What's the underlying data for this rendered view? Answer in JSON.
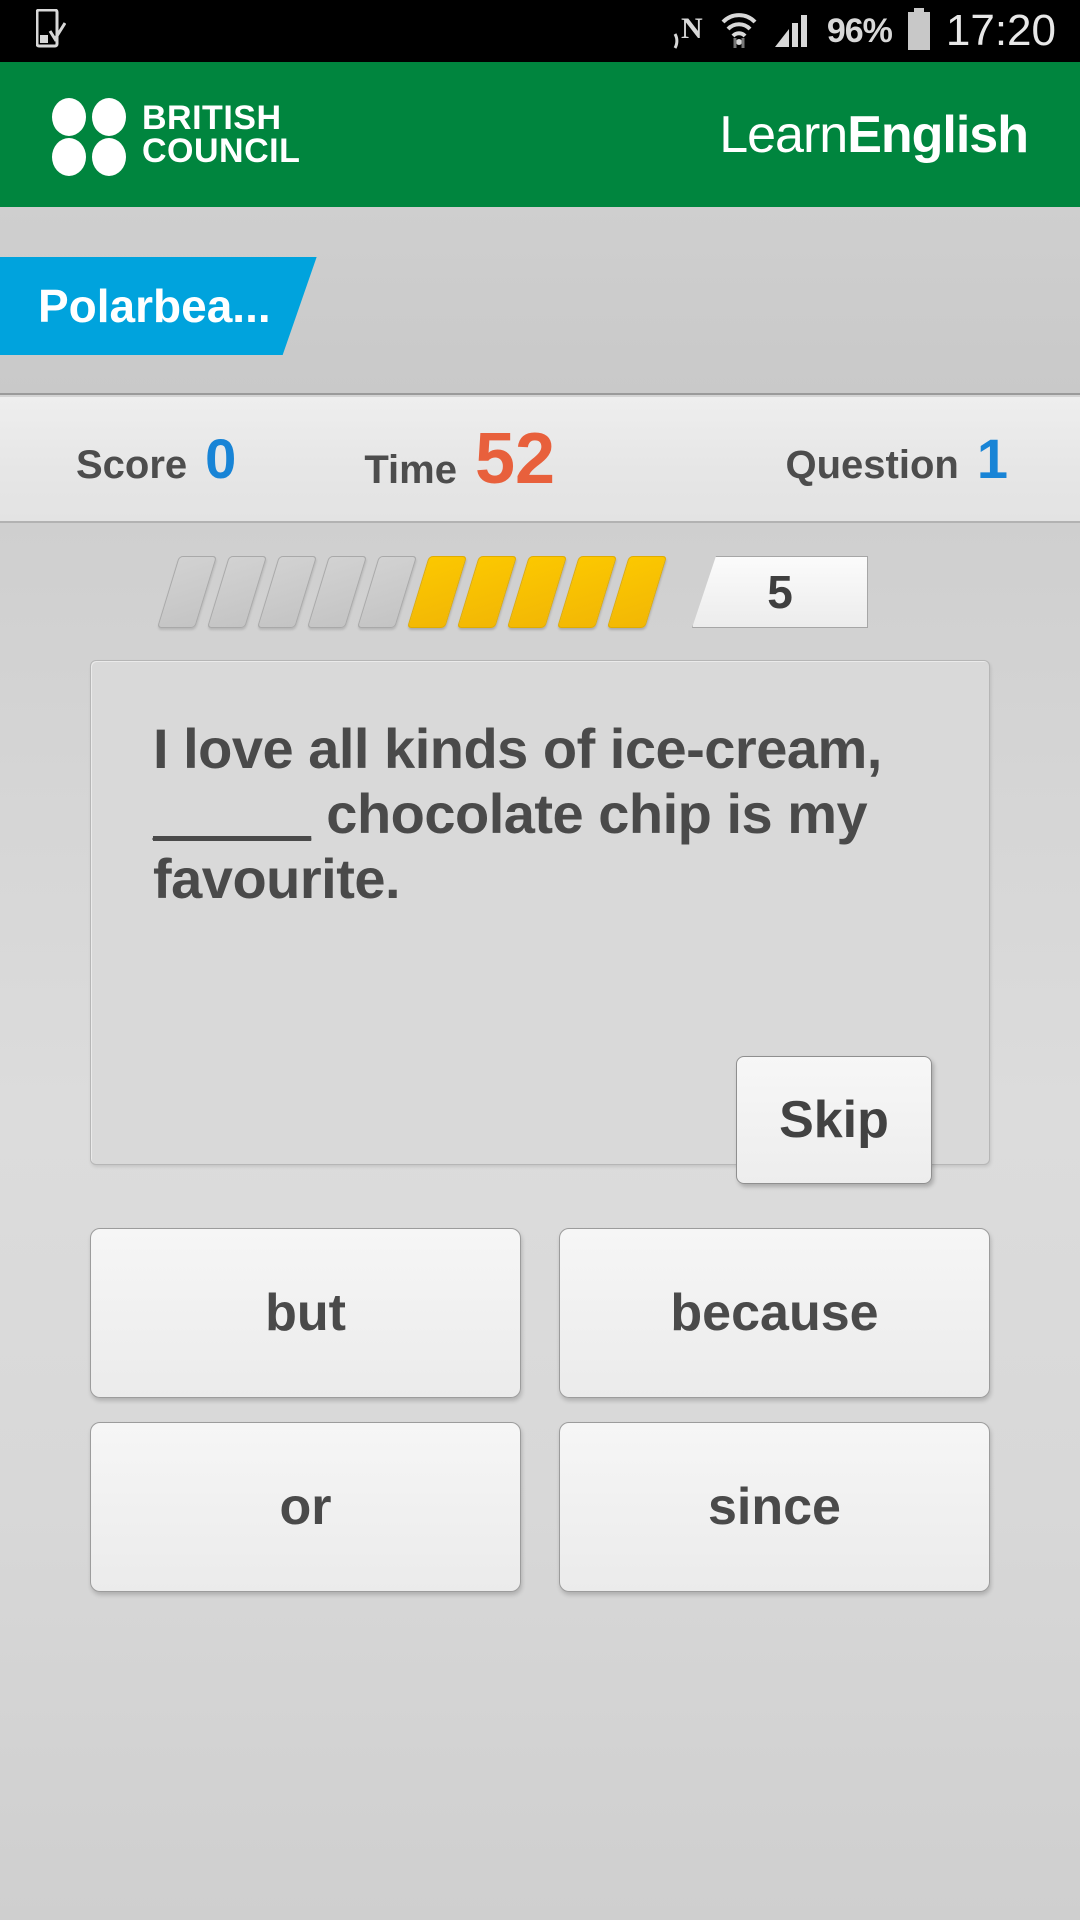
{
  "status_bar": {
    "battery_percent": "96%",
    "clock": "17:20",
    "icons": [
      "sd-card-save-icon",
      "nfc-icon",
      "wifi-icon",
      "cellular-signal-icon",
      "battery-icon"
    ]
  },
  "brand_header": {
    "logo_line1": "BRITISH",
    "logo_line2": "COUNCIL",
    "product_thin": "Learn",
    "product_bold": "English",
    "background_color": "#00853e"
  },
  "tab": {
    "label": "Polarbea...",
    "color": "#00a3dd"
  },
  "stats": {
    "score_label": "Score",
    "score_value": "0",
    "score_color": "#1884d6",
    "time_label": "Time",
    "time_value": "52",
    "time_color": "#e8603c",
    "question_label": "Question",
    "question_value": "1",
    "question_color": "#1884d6"
  },
  "progress": {
    "total": 10,
    "filled": 5,
    "remaining_count": "5",
    "filled_color": "#fbc200",
    "empty_color": "#cacaca"
  },
  "question": {
    "text_before": "I love all kinds of ice-cream,",
    "blank": "_____",
    "text_after": "chocolate chip is my favourite.",
    "full_text": "I love all kinds of ice-cream, _____ chocolate chip is my favourite.",
    "skip_label": "Skip"
  },
  "answers": [
    {
      "label": "but"
    },
    {
      "label": "because"
    },
    {
      "label": "or"
    },
    {
      "label": "since"
    }
  ]
}
